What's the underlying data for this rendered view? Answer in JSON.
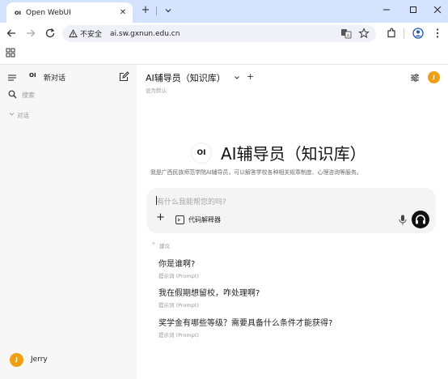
{
  "browser": {
    "tab_title": "Open WebUI",
    "tab_favicon": "OI",
    "security_label": "不安全",
    "url": "ai.sw.gxnun.edu.cn"
  },
  "sidebar": {
    "logo_text": "OI",
    "new_chat_label": "新对话",
    "search_label": "搜索",
    "section_label": "对话",
    "user_initial": "J",
    "user_name": "Jerry"
  },
  "header": {
    "model_name": "AI辅导员（知识库）",
    "set_default_label": "设为默认",
    "avatar_initial": "J"
  },
  "hero": {
    "logo_text": "OI",
    "title": "AI辅导员（知识库）",
    "description": "我是广西民族师范学院AI辅导员，可以解答学校各种相关规章制度、心理咨询等服务。"
  },
  "composer": {
    "placeholder": "有什么我能帮您的吗?",
    "tool_label": "代码解释器"
  },
  "suggestions": {
    "heading": "建议",
    "items": [
      {
        "title": "你是谁啊?",
        "subtitle": "提示词 (Prompt)"
      },
      {
        "title": "我在假期想留校，咋处理啊?",
        "subtitle": "提示词 (Prompt)"
      },
      {
        "title": "奖学金有哪些等级？需要具备什么条件才能获得?",
        "subtitle": "提示词 (Prompt)"
      }
    ]
  },
  "colors": {
    "accent_avatar": "#f59e0b",
    "browser_tabstrip": "#d3e3fd",
    "sidebar_bg": "#f7f7f8"
  }
}
